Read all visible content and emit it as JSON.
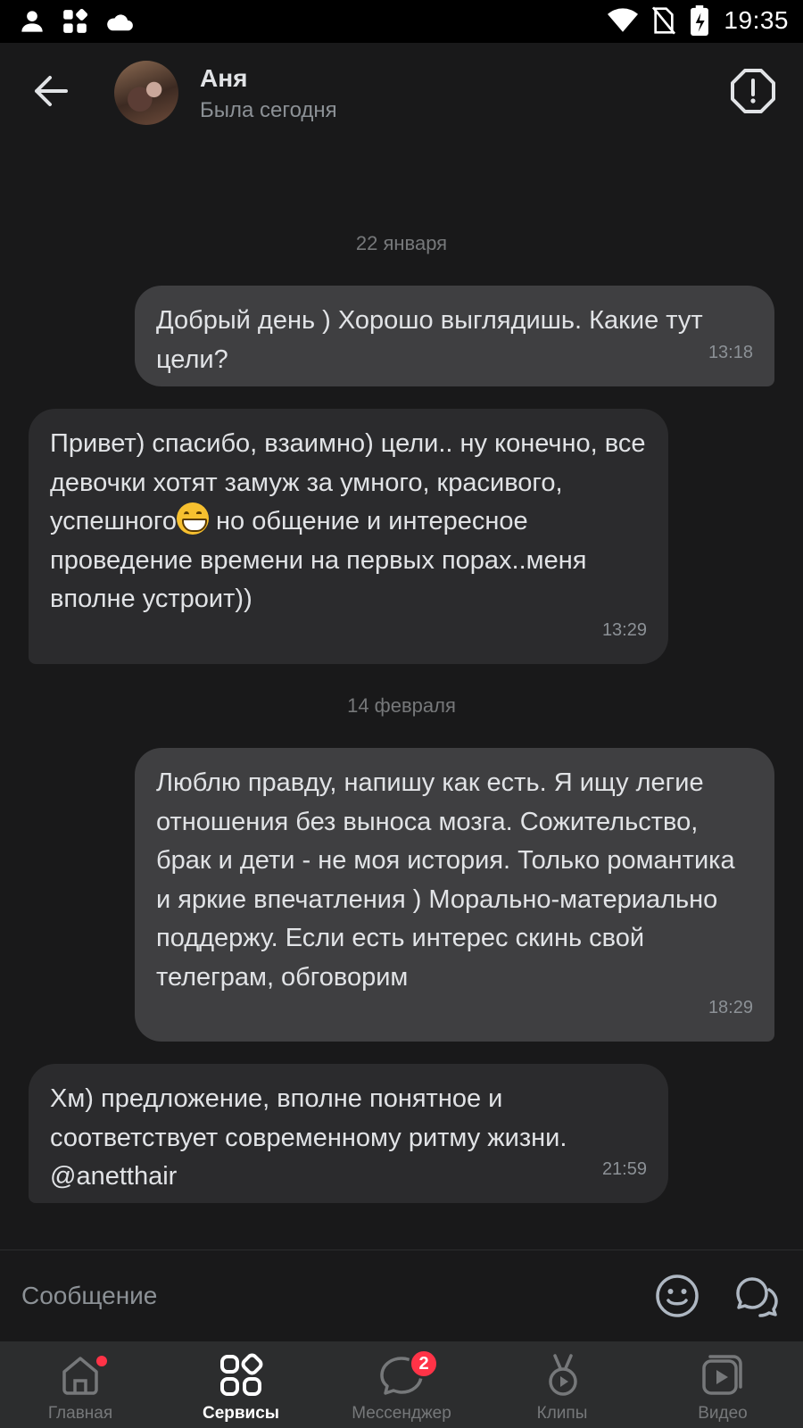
{
  "status_bar": {
    "time": "19:35",
    "left_icons": [
      "person-icon",
      "apps-icon",
      "cloud-icon"
    ],
    "right_icons": [
      "wifi-icon",
      "no-sim-icon",
      "battery-charging-icon"
    ]
  },
  "header": {
    "contact_name": "Аня",
    "contact_status": "Была сегодня"
  },
  "messages": [
    {
      "type": "date",
      "text": "22 января"
    },
    {
      "type": "out",
      "text": "Добрый день ) Хорошо выглядишь. Какие тут цели?",
      "time": "13:18"
    },
    {
      "type": "in",
      "text_before_emoji": "Привет) спасибо, взаимно) цели.. ну конечно, все девочки хотят замуж за умного, красивого, успешного",
      "emoji": "grinning-face-emoji",
      "text_after_emoji": " но общение и интересное проведение времени на первых порах..меня вполне устроит))",
      "time": "13:29"
    },
    {
      "type": "date",
      "text": "14 февраля"
    },
    {
      "type": "out",
      "text": "Люблю правду, напишу как есть. Я ищу легие отношения без выноса мозга. Сожительство, брак и дети - не моя история. Только романтика и яркие впечатления ) Морально-материально поддержу. Если есть интерес скинь свой телеграм, обговорим",
      "time": "18:29"
    },
    {
      "type": "in",
      "text": "Хм) предложение, вполне понятное и соответствует современному ритму жизни. @anetthair",
      "time": "21:59"
    }
  ],
  "composer": {
    "placeholder": "Сообщение",
    "value": ""
  },
  "tabbar": {
    "tabs": [
      {
        "label": "Главная",
        "icon": "home-icon",
        "has_dot": true
      },
      {
        "label": "Сервисы",
        "icon": "services-icon",
        "active": true
      },
      {
        "label": "Мессенджер",
        "icon": "messenger-icon",
        "badge": "2"
      },
      {
        "label": "Клипы",
        "icon": "clips-icon"
      },
      {
        "label": "Видео",
        "icon": "video-icon"
      }
    ]
  },
  "colors": {
    "background": "#19191a",
    "bubble_out": "#3f3f41",
    "bubble_in": "#2b2b2d",
    "tabbar": "#2c2d2e",
    "badge": "#ff3347",
    "secondary_text": "#8c9196"
  }
}
